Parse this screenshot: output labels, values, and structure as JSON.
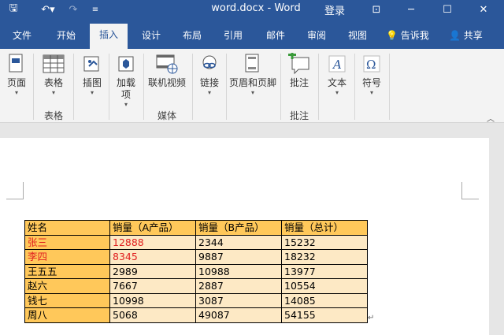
{
  "titlebar": {
    "title": "word.docx - Word",
    "login": "登录",
    "qa_icons": [
      "save-icon",
      "undo-icon",
      "redo-icon",
      "customize-icon"
    ],
    "win_icons": [
      "ribbon-display-icon",
      "minimize-icon",
      "maximize-icon",
      "close-icon"
    ],
    "qa_glyphs": [
      "🖫",
      "↶▾",
      "↷",
      "≡"
    ],
    "win_glyphs": [
      "⊡",
      "─",
      "☐",
      "✕"
    ]
  },
  "tabs": [
    "文件",
    "开始",
    "插入",
    "设计",
    "布局",
    "引用",
    "邮件",
    "审阅",
    "视图"
  ],
  "active_tab": "插入",
  "tell_me": "告诉我",
  "share": "共享",
  "ribbon": {
    "buttons": [
      {
        "label": "页面",
        "icon": "page-icon"
      },
      {
        "label": "表格",
        "icon": "table-icon"
      },
      {
        "label": "插图",
        "icon": "illustrations-icon"
      },
      {
        "label": "加载\n项",
        "icon": "addins-icon"
      },
      {
        "label": "联机视频",
        "icon": "online-video-icon"
      },
      {
        "label": "链接",
        "icon": "link-icon"
      },
      {
        "label": "页眉和页脚",
        "icon": "header-footer-icon"
      },
      {
        "label": "批注",
        "icon": "comment-icon"
      },
      {
        "label": "文本",
        "icon": "text-icon"
      },
      {
        "label": "符号",
        "icon": "symbol-icon"
      }
    ],
    "groups": [
      "表格",
      "媒体",
      "批注"
    ]
  },
  "table": {
    "headers": [
      "姓名",
      "销量（A产品）",
      "销量（B产品）",
      "销量（总计）"
    ],
    "rows": [
      [
        "张三",
        "12888",
        "2344",
        "15232"
      ],
      [
        "李四",
        "8345",
        "9887",
        "18232"
      ],
      [
        "王五五",
        "2989",
        "10988",
        "13977"
      ],
      [
        "赵六",
        "7667",
        "2887",
        "10554"
      ],
      [
        "钱七",
        "10998",
        "3087",
        "14085"
      ],
      [
        "周八",
        "5068",
        "49087",
        "54155"
      ]
    ]
  },
  "colors": {
    "title_bar": "#2b579a",
    "header_fill": "#ffc85a",
    "row_fill": "#fde9c5",
    "highlight_text": "#e02020"
  }
}
